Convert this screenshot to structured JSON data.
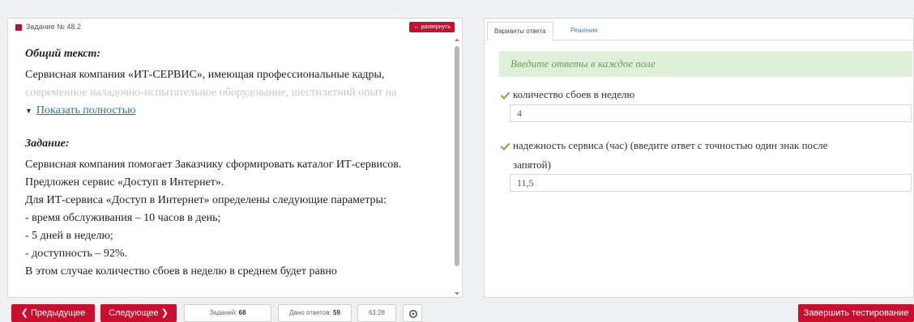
{
  "task": {
    "title": "Задание № 48.2",
    "expand_label": "развернуть",
    "general_heading": "Общий текст:",
    "general_line1": "Сервисная компания «ИТ-СЕРВИС», имеющая профессиональные кадры,",
    "general_line2_faded": "современное наладочно-испытательное оборудование, шестилетний опыт на",
    "show_full_label": "Показать полностью",
    "task_heading": "Задание:",
    "lines": [
      "Сервисная компания помогает Заказчику сформировать каталог ИТ-сервисов.",
      "Предложен сервис «Доступ в Интернет».",
      "Для ИТ-сервиса «Доступ в Интернет» определены следующие параметры:",
      "- время обслуживания – 10 часов в день;",
      "- 5 дней в неделю;",
      "- доступность – 92%.",
      "В этом случае количество сбоев в неделю в среднем будет равно"
    ]
  },
  "tabs": {
    "answers": "Варианты ответа",
    "solution": "Решение"
  },
  "notice": "Введите ответы в каждое поле",
  "questions": [
    {
      "label": "количество сбоев в неделю",
      "value": "4"
    },
    {
      "label_line1": "надежность сервиса (час) (введите ответ с точностью один знак после",
      "label_line2": "запятой)",
      "value": "11,5"
    }
  ],
  "footer": {
    "prev_label": "Предыдущее",
    "next_label": "Следующее",
    "tasks_label": "Заданий:",
    "tasks_count": "68",
    "answers_label": "Дано ответов:",
    "answers_count": "59",
    "timer": "63:28",
    "finish_label": "Завершить тестирование"
  },
  "colors": {
    "accent": "#c8102e",
    "notice_bg": "#dff0d8",
    "notice_text": "#6a9d5a",
    "link": "#2a6fb0"
  },
  "icons": [
    "red-square-icon",
    "expand-arrows-icon",
    "chevron-down-icon",
    "checkmark-icon",
    "chevron-left-icon",
    "chevron-right-icon",
    "gear-icon"
  ]
}
